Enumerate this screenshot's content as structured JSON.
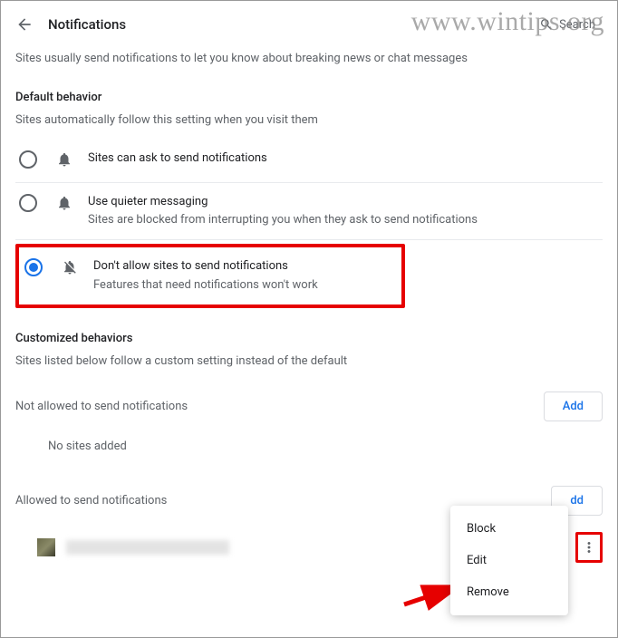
{
  "watermark": "www.wintips.org",
  "header": {
    "title": "Notifications",
    "search_placeholder": "Search"
  },
  "intro": "Sites usually send notifications to let you know about breaking news or chat messages",
  "default_behavior": {
    "title": "Default behavior",
    "subtitle": "Sites automatically follow this setting when you visit them",
    "options": [
      {
        "label": "Sites can ask to send notifications",
        "sub": ""
      },
      {
        "label": "Use quieter messaging",
        "sub": "Sites are blocked from interrupting you when they ask to send notifications"
      },
      {
        "label": "Don't allow sites to send notifications",
        "sub": "Features that need notifications won't work"
      }
    ]
  },
  "customized": {
    "title": "Customized behaviors",
    "subtitle": "Sites listed below follow a custom setting instead of the default"
  },
  "not_allowed": {
    "title": "Not allowed to send notifications",
    "add": "Add",
    "empty": "No sites added"
  },
  "allowed": {
    "title": "Allowed to send notifications",
    "add": "dd"
  },
  "menu": {
    "block": "Block",
    "edit": "Edit",
    "remove": "Remove"
  }
}
